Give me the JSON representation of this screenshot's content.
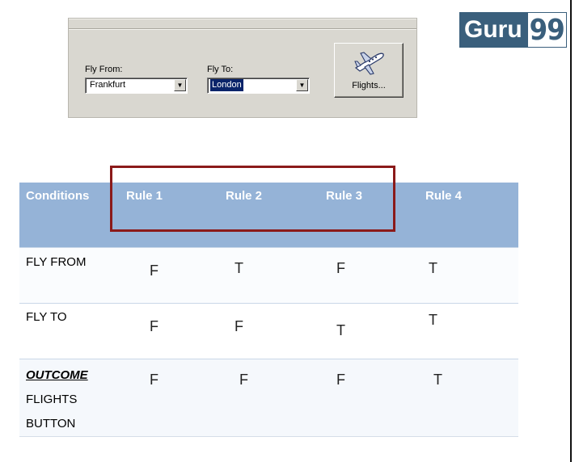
{
  "logo": {
    "word": "Guru",
    "number": "99"
  },
  "dialog": {
    "fly_from_label": "Fly From:",
    "fly_from_value": "Frankfurt",
    "fly_to_label": "Fly To:",
    "fly_to_value": "London",
    "flights_button_label": "Flights..."
  },
  "table": {
    "headers": [
      "Conditions",
      "Rule 1",
      "Rule 2",
      "Rule 3",
      "Rule 4"
    ],
    "rows": [
      {
        "condition": "FLY FROM",
        "values": [
          "F",
          "T",
          "F",
          "T"
        ]
      },
      {
        "condition": "FLY TO",
        "values": [
          "F",
          "F",
          "T",
          "T"
        ]
      }
    ],
    "outcome": {
      "title": "OUTCOME",
      "line1": "FLIGHTS",
      "line2": "BUTTON",
      "values": [
        "F",
        "F",
        "F",
        "T"
      ]
    }
  },
  "colors": {
    "header_bg": "#95b3d7",
    "highlight": "#8b1a1a",
    "logo_bg": "#3a5f7c"
  }
}
